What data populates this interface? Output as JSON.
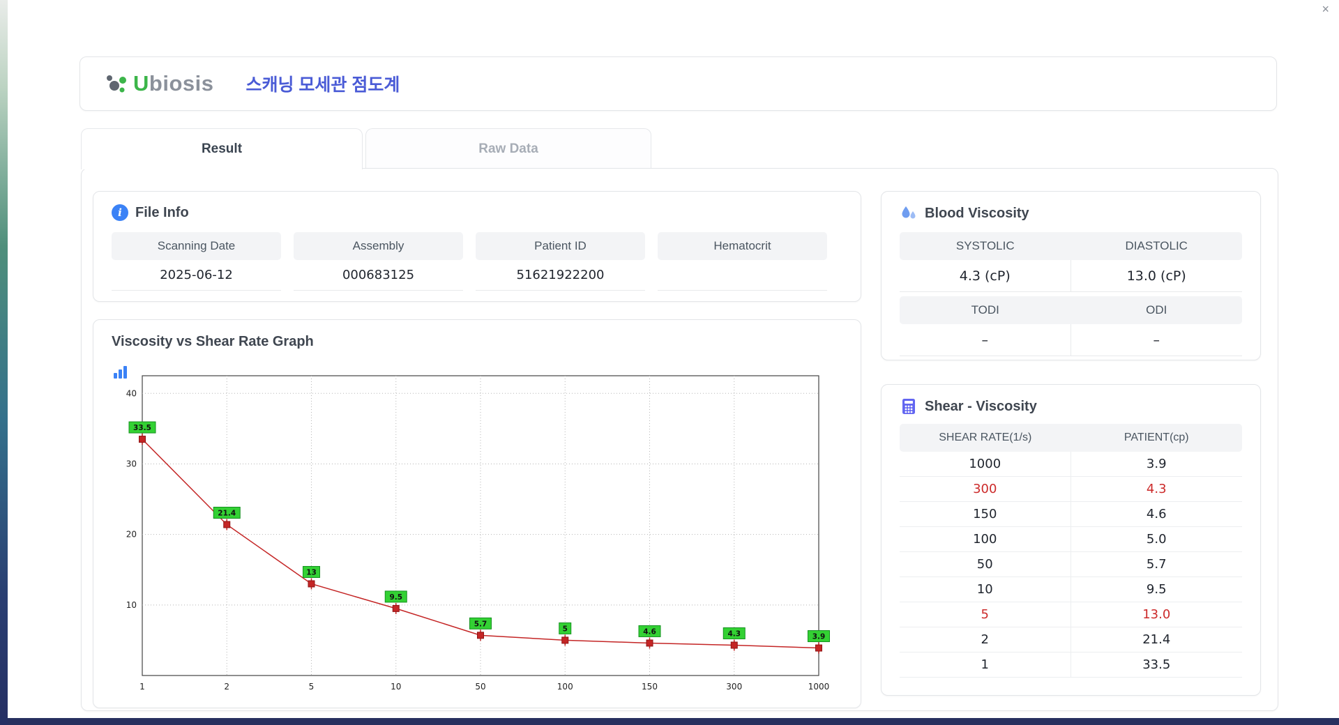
{
  "window": {
    "close_icon": "×"
  },
  "header": {
    "brand_first": "U",
    "brand_rest": "biosis",
    "title_korean": "스캐닝 모세관 점도계"
  },
  "tabs": {
    "result": "Result",
    "raw_data": "Raw Data"
  },
  "file_info": {
    "title": "File Info",
    "fields": [
      {
        "label": "Scanning Date",
        "value": "2025-06-12"
      },
      {
        "label": "Assembly",
        "value": "000683125"
      },
      {
        "label": "Patient ID",
        "value": "51621922200"
      },
      {
        "label": "Hematocrit",
        "value": ""
      }
    ]
  },
  "graph_panel": {
    "title": "Viscosity vs Shear Rate Graph"
  },
  "blood_viscosity": {
    "title": "Blood Viscosity",
    "col1_header": "SYSTOLIC",
    "col2_header": "DIASTOLIC",
    "col1_value": "4.3 (cP)",
    "col2_value": "13.0 (cP)",
    "col3_header": "TODI",
    "col4_header": "ODI",
    "col3_value": "–",
    "col4_value": "–"
  },
  "shear_viscosity": {
    "title": "Shear - Viscosity",
    "columns": [
      "SHEAR RATE(1/s)",
      "PATIENT(cp)"
    ],
    "rows": [
      {
        "rate": "1000",
        "patient": "3.9",
        "highlight": false
      },
      {
        "rate": "300",
        "patient": "4.3",
        "highlight": true
      },
      {
        "rate": "150",
        "patient": "4.6",
        "highlight": false
      },
      {
        "rate": "100",
        "patient": "5.0",
        "highlight": false
      },
      {
        "rate": "50",
        "patient": "5.7",
        "highlight": false
      },
      {
        "rate": "10",
        "patient": "9.5",
        "highlight": false
      },
      {
        "rate": "5",
        "patient": "13.0",
        "highlight": true
      },
      {
        "rate": "2",
        "patient": "21.4",
        "highlight": false
      },
      {
        "rate": "1",
        "patient": "33.5",
        "highlight": false
      }
    ]
  },
  "chart_data": {
    "type": "line",
    "title": "Viscosity vs Shear Rate Graph",
    "x": [
      1,
      2,
      5,
      10,
      50,
      100,
      150,
      300,
      1000
    ],
    "x_tick_labels": [
      "1",
      "2",
      "5",
      "10",
      "50",
      "100",
      "150",
      "300",
      "1000"
    ],
    "values": [
      33.5,
      21.4,
      13,
      9.5,
      5.7,
      5,
      4.6,
      4.3,
      3.9
    ],
    "point_labels": [
      "33.5",
      "21.4",
      "13",
      "9.5",
      "5.7",
      "5",
      "4.6",
      "4.3",
      "3.9"
    ],
    "y_ticks": [
      10,
      20,
      30,
      40
    ],
    "ylim": [
      0,
      42.5
    ],
    "x_spacing": "equal",
    "grid": true,
    "line_color": "#c42525",
    "marker_color": "#c42525",
    "label_bg": "#33d133",
    "label_border": "#14911f"
  }
}
